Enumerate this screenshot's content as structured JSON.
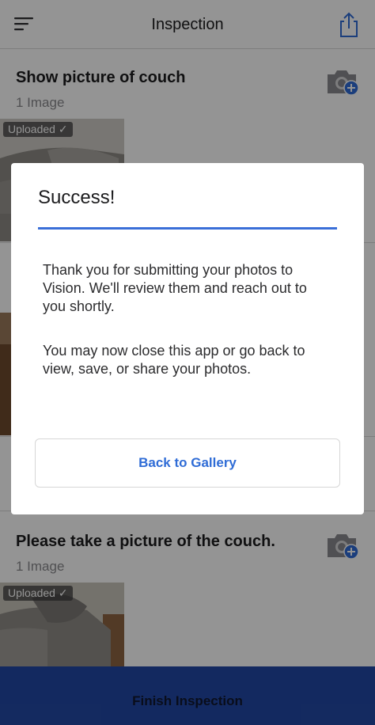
{
  "header": {
    "title": "Inspection",
    "menu_icon": "hamburger-menu-icon",
    "share_icon": "share-icon"
  },
  "sections": [
    {
      "title": "Show picture of couch",
      "count": "1 Image",
      "badge": "Uploaded ✓"
    },
    {
      "title": "Please take a picture of the couch.",
      "count": "1 Image",
      "badge": "Uploaded ✓"
    }
  ],
  "partial_badge": "U",
  "modal": {
    "title": "Success!",
    "message_1": "Thank you for submitting your photos to Vision. We'll review them and reach out to you shortly.",
    "message_2": "You may now close this app or go back to view, save, or share your photos.",
    "button_label": "Back to Gallery"
  },
  "footer": {
    "finish_label": "Finish Inspection"
  },
  "colors": {
    "accent": "#3a6fd8",
    "button_text": "#2f6cd6",
    "finish_bar": "#2248a6",
    "camera_badge": "#2f6cd6"
  }
}
